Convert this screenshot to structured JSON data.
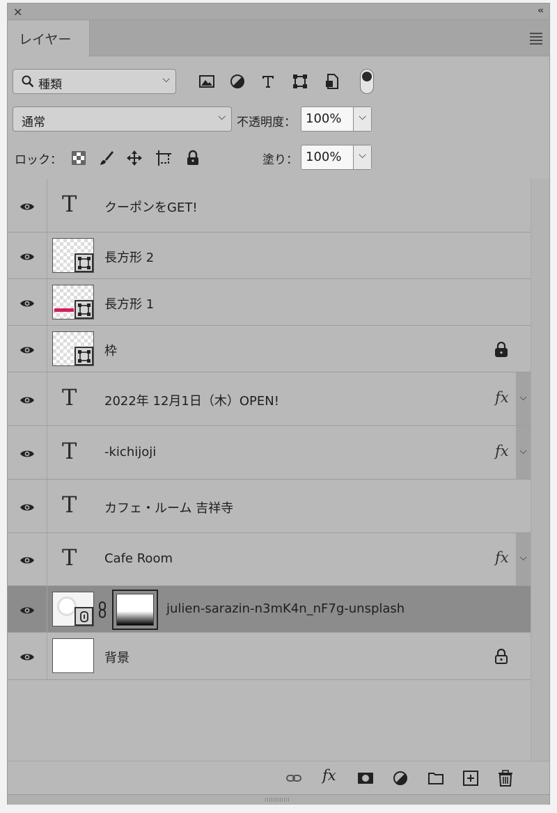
{
  "window": {
    "close": "✕",
    "collapse": "‹‹"
  },
  "tab": {
    "label": "レイヤー"
  },
  "filter": {
    "label": "種類",
    "icons": [
      "image-filter-icon",
      "adjustment-filter-icon",
      "type-filter-icon",
      "shape-filter-icon",
      "smart-object-filter-icon"
    ],
    "toggle_on": true
  },
  "blend": {
    "mode": "通常",
    "opacity_label": "不透明度：",
    "opacity": "100%"
  },
  "lock": {
    "label": "ロック：",
    "icons": [
      "lock-transparent-icon",
      "lock-image-icon",
      "lock-position-icon",
      "lock-artboard-icon",
      "lock-all-icon"
    ],
    "fill_label": "塗り：",
    "fill": "100%"
  },
  "layers": [
    {
      "name": "クーポンをGET!",
      "kind": "text",
      "fx": false,
      "locked": false
    },
    {
      "name": "長方形 2",
      "kind": "shape",
      "fx": false,
      "locked": false
    },
    {
      "name": "長方形 1",
      "kind": "shape-pink",
      "fx": false,
      "locked": false
    },
    {
      "name": "枠",
      "kind": "shape",
      "fx": false,
      "locked": true
    },
    {
      "name": "2022年 12月1日（木）OPEN!",
      "kind": "text",
      "fx": true,
      "fx_label": "fx",
      "locked": false
    },
    {
      "name": "-kichijoji",
      "kind": "text",
      "fx": true,
      "fx_label": "fx",
      "locked": false
    },
    {
      "name": "カフェ・ルーム 吉祥寺",
      "kind": "text",
      "fx": false,
      "locked": false
    },
    {
      "name": "Cafe Room",
      "kind": "text",
      "fx": true,
      "fx_label": "fx",
      "locked": false
    },
    {
      "name": "julien-sarazin-n3mK4n_nF7g-unsplash",
      "kind": "smart-masked",
      "selected": true,
      "fx": false,
      "locked": false
    },
    {
      "name": "背景",
      "kind": "background",
      "fx": false,
      "locked": true
    }
  ],
  "footer": {
    "fx_label": "fx",
    "icons": [
      "link-icon",
      "fx-icon",
      "mask-icon",
      "adjustment-icon",
      "folder-icon",
      "new-layer-icon",
      "trash-icon"
    ]
  }
}
